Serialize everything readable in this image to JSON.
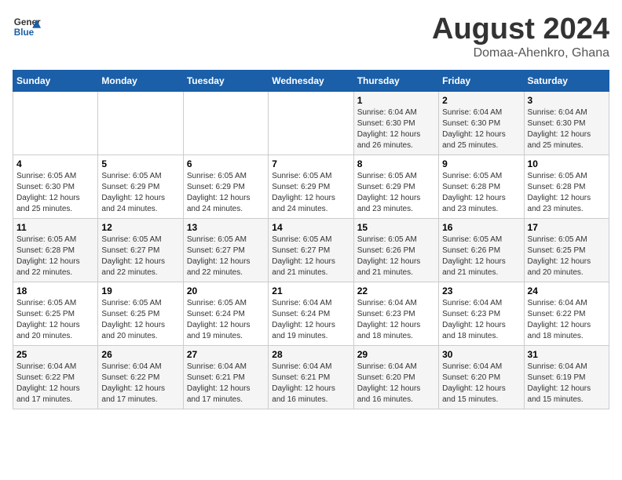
{
  "header": {
    "logo_line1": "General",
    "logo_line2": "Blue",
    "month": "August 2024",
    "location": "Domaa-Ahenkro, Ghana"
  },
  "weekdays": [
    "Sunday",
    "Monday",
    "Tuesday",
    "Wednesday",
    "Thursday",
    "Friday",
    "Saturday"
  ],
  "weeks": [
    [
      {
        "day": "",
        "info": ""
      },
      {
        "day": "",
        "info": ""
      },
      {
        "day": "",
        "info": ""
      },
      {
        "day": "",
        "info": ""
      },
      {
        "day": "1",
        "info": "Sunrise: 6:04 AM\nSunset: 6:30 PM\nDaylight: 12 hours\nand 26 minutes."
      },
      {
        "day": "2",
        "info": "Sunrise: 6:04 AM\nSunset: 6:30 PM\nDaylight: 12 hours\nand 25 minutes."
      },
      {
        "day": "3",
        "info": "Sunrise: 6:04 AM\nSunset: 6:30 PM\nDaylight: 12 hours\nand 25 minutes."
      }
    ],
    [
      {
        "day": "4",
        "info": "Sunrise: 6:05 AM\nSunset: 6:30 PM\nDaylight: 12 hours\nand 25 minutes."
      },
      {
        "day": "5",
        "info": "Sunrise: 6:05 AM\nSunset: 6:29 PM\nDaylight: 12 hours\nand 24 minutes."
      },
      {
        "day": "6",
        "info": "Sunrise: 6:05 AM\nSunset: 6:29 PM\nDaylight: 12 hours\nand 24 minutes."
      },
      {
        "day": "7",
        "info": "Sunrise: 6:05 AM\nSunset: 6:29 PM\nDaylight: 12 hours\nand 24 minutes."
      },
      {
        "day": "8",
        "info": "Sunrise: 6:05 AM\nSunset: 6:29 PM\nDaylight: 12 hours\nand 23 minutes."
      },
      {
        "day": "9",
        "info": "Sunrise: 6:05 AM\nSunset: 6:28 PM\nDaylight: 12 hours\nand 23 minutes."
      },
      {
        "day": "10",
        "info": "Sunrise: 6:05 AM\nSunset: 6:28 PM\nDaylight: 12 hours\nand 23 minutes."
      }
    ],
    [
      {
        "day": "11",
        "info": "Sunrise: 6:05 AM\nSunset: 6:28 PM\nDaylight: 12 hours\nand 22 minutes."
      },
      {
        "day": "12",
        "info": "Sunrise: 6:05 AM\nSunset: 6:27 PM\nDaylight: 12 hours\nand 22 minutes."
      },
      {
        "day": "13",
        "info": "Sunrise: 6:05 AM\nSunset: 6:27 PM\nDaylight: 12 hours\nand 22 minutes."
      },
      {
        "day": "14",
        "info": "Sunrise: 6:05 AM\nSunset: 6:27 PM\nDaylight: 12 hours\nand 21 minutes."
      },
      {
        "day": "15",
        "info": "Sunrise: 6:05 AM\nSunset: 6:26 PM\nDaylight: 12 hours\nand 21 minutes."
      },
      {
        "day": "16",
        "info": "Sunrise: 6:05 AM\nSunset: 6:26 PM\nDaylight: 12 hours\nand 21 minutes."
      },
      {
        "day": "17",
        "info": "Sunrise: 6:05 AM\nSunset: 6:25 PM\nDaylight: 12 hours\nand 20 minutes."
      }
    ],
    [
      {
        "day": "18",
        "info": "Sunrise: 6:05 AM\nSunset: 6:25 PM\nDaylight: 12 hours\nand 20 minutes."
      },
      {
        "day": "19",
        "info": "Sunrise: 6:05 AM\nSunset: 6:25 PM\nDaylight: 12 hours\nand 20 minutes."
      },
      {
        "day": "20",
        "info": "Sunrise: 6:05 AM\nSunset: 6:24 PM\nDaylight: 12 hours\nand 19 minutes."
      },
      {
        "day": "21",
        "info": "Sunrise: 6:04 AM\nSunset: 6:24 PM\nDaylight: 12 hours\nand 19 minutes."
      },
      {
        "day": "22",
        "info": "Sunrise: 6:04 AM\nSunset: 6:23 PM\nDaylight: 12 hours\nand 18 minutes."
      },
      {
        "day": "23",
        "info": "Sunrise: 6:04 AM\nSunset: 6:23 PM\nDaylight: 12 hours\nand 18 minutes."
      },
      {
        "day": "24",
        "info": "Sunrise: 6:04 AM\nSunset: 6:22 PM\nDaylight: 12 hours\nand 18 minutes."
      }
    ],
    [
      {
        "day": "25",
        "info": "Sunrise: 6:04 AM\nSunset: 6:22 PM\nDaylight: 12 hours\nand 17 minutes."
      },
      {
        "day": "26",
        "info": "Sunrise: 6:04 AM\nSunset: 6:22 PM\nDaylight: 12 hours\nand 17 minutes."
      },
      {
        "day": "27",
        "info": "Sunrise: 6:04 AM\nSunset: 6:21 PM\nDaylight: 12 hours\nand 17 minutes."
      },
      {
        "day": "28",
        "info": "Sunrise: 6:04 AM\nSunset: 6:21 PM\nDaylight: 12 hours\nand 16 minutes."
      },
      {
        "day": "29",
        "info": "Sunrise: 6:04 AM\nSunset: 6:20 PM\nDaylight: 12 hours\nand 16 minutes."
      },
      {
        "day": "30",
        "info": "Sunrise: 6:04 AM\nSunset: 6:20 PM\nDaylight: 12 hours\nand 15 minutes."
      },
      {
        "day": "31",
        "info": "Sunrise: 6:04 AM\nSunset: 6:19 PM\nDaylight: 12 hours\nand 15 minutes."
      }
    ]
  ]
}
